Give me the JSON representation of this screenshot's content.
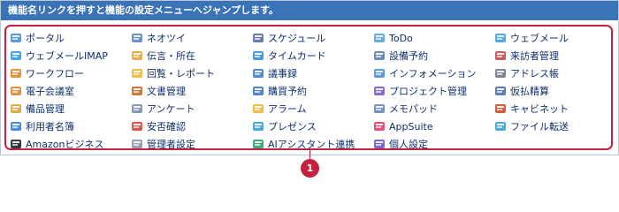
{
  "header": {
    "title": "機能名リンクを押すと機能の設定メニューへジャンプします。"
  },
  "menu": {
    "items": [
      {
        "label": "ポータル",
        "icon": "portal-icon",
        "color": "#4a8fd8"
      },
      {
        "label": "ネオツイ",
        "icon": "neotwi-icon",
        "color": "#5b86c6"
      },
      {
        "label": "スケジュール",
        "icon": "schedule-icon",
        "color": "#5a6fa3"
      },
      {
        "label": "ToDo",
        "icon": "todo-icon",
        "color": "#58a2d9"
      },
      {
        "label": "ウェブメール",
        "icon": "webmail-icon",
        "color": "#3fa2e2"
      },
      {
        "label": "ウェブメールIMAP",
        "icon": "webmail-imap-icon",
        "color": "#2f9be0"
      },
      {
        "label": "伝言・所在",
        "icon": "message-icon",
        "color": "#e7a53a"
      },
      {
        "label": "タイムカード",
        "icon": "timecard-icon",
        "color": "#3a8fd1"
      },
      {
        "label": "設備予約",
        "icon": "facility-icon",
        "color": "#5b7fb8"
      },
      {
        "label": "来訪者管理",
        "icon": "visitor-icon",
        "color": "#c34a4a"
      },
      {
        "label": "ワークフロー",
        "icon": "workflow-icon",
        "color": "#e08a2e"
      },
      {
        "label": "回覧・レポート",
        "icon": "circular-icon",
        "color": "#f0b63a"
      },
      {
        "label": "議事録",
        "icon": "minutes-icon",
        "color": "#3f7fc9"
      },
      {
        "label": "インフォメーション",
        "icon": "information-icon",
        "color": "#4a8fd8"
      },
      {
        "label": "アドレス帳",
        "icon": "addressbook-icon",
        "color": "#6f7a86"
      },
      {
        "label": "電子会議室",
        "icon": "conference-icon",
        "color": "#d9893a"
      },
      {
        "label": "文書管理",
        "icon": "document-icon",
        "color": "#c46a2a"
      },
      {
        "label": "購買予約",
        "icon": "purchase-icon",
        "color": "#3f79c0"
      },
      {
        "label": "プロジェクト管理",
        "icon": "project-icon",
        "color": "#7a5cc2"
      },
      {
        "label": "仮払精算",
        "icon": "expense-icon",
        "color": "#4b6fa7"
      },
      {
        "label": "備品管理",
        "icon": "equipment-icon",
        "color": "#d7a43a"
      },
      {
        "label": "アンケート",
        "icon": "survey-icon",
        "color": "#7b8fa8"
      },
      {
        "label": "アラーム",
        "icon": "alarm-icon",
        "color": "#f0b43a"
      },
      {
        "label": "メモパッド",
        "icon": "memopad-icon",
        "color": "#6688b6"
      },
      {
        "label": "キャビネット",
        "icon": "cabinet-icon",
        "color": "#d04a2c"
      },
      {
        "label": "利用者名簿",
        "icon": "userlist-icon",
        "color": "#3b7fce"
      },
      {
        "label": "安否確認",
        "icon": "safety-icon",
        "color": "#d8463b"
      },
      {
        "label": "プレゼンス",
        "icon": "presence-icon",
        "color": "#39a0d8"
      },
      {
        "label": "AppSuite",
        "icon": "appsuite-icon",
        "color": "#e23e6a"
      },
      {
        "label": "ファイル転送",
        "icon": "filetransfer-icon",
        "color": "#36a1d8"
      },
      {
        "label": "Amazonビジネス",
        "icon": "amazon-icon",
        "color": "#1b2530"
      },
      {
        "label": "管理者設定",
        "icon": "admin-settings-icon",
        "color": "#8a97a8"
      },
      {
        "label": "AIアシスタント連携",
        "icon": "ai-assistant-icon",
        "color": "#2ea36a"
      },
      {
        "label": "個人設定",
        "icon": "personal-settings-icon",
        "color": "#6a5acd"
      }
    ]
  },
  "callout": {
    "number": "1"
  }
}
